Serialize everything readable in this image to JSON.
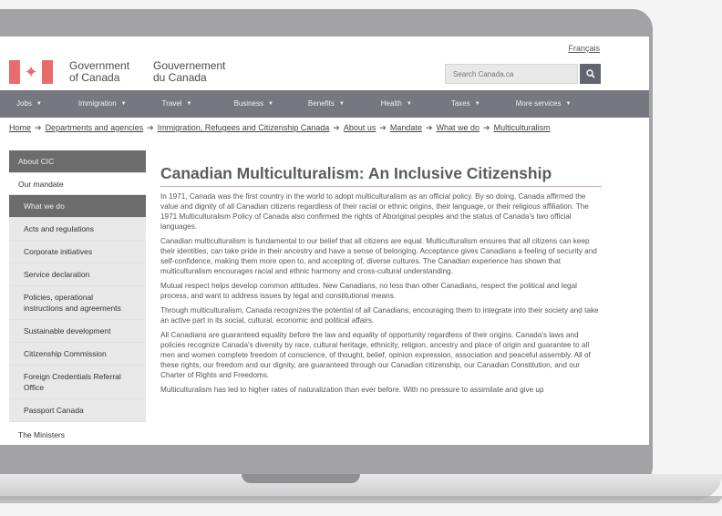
{
  "header": {
    "language_link": "Français",
    "wordmark_en_line1": "Government",
    "wordmark_en_line2": "of Canada",
    "wordmark_fr_line1": "Gouvernement",
    "wordmark_fr_line2": "du Canada",
    "search_placeholder": "Search Canada.ca"
  },
  "nav": {
    "items": [
      {
        "label": "Jobs"
      },
      {
        "label": "Immigration"
      },
      {
        "label": "Travel"
      },
      {
        "label": "Business"
      },
      {
        "label": "Benefits"
      },
      {
        "label": "Health"
      },
      {
        "label": "Taxes"
      },
      {
        "label": "More services"
      }
    ]
  },
  "breadcrumb": [
    "Home",
    "Departments and agencies",
    "Immigration, Refugees and Citizenship Canada",
    "About us",
    "Mandate",
    "What we do",
    "Multiculturalism"
  ],
  "sidebar": {
    "heading": "About CIC",
    "mandate": "Our mandate",
    "active": "What we do",
    "sub_items": [
      "Acts and regulations",
      "Corporate initiatives",
      "Service declaration",
      "Policies, operational instructions and agreements",
      "Sustainable development",
      "Citizenship Commission",
      "Foreign Credentials Referral Office",
      "Passport Canada"
    ],
    "ministers": "The Ministers"
  },
  "main": {
    "title": "Canadian Multiculturalism: An Inclusive Citizenship",
    "paragraphs": [
      "In 1971, Canada was the first country in the world to adopt multiculturalism as an official policy. By so doing, Canada affirmed the value and dignity of all Canadian citizens regardless of their racial or ethnic origins, their language, or their religious affiliation. The 1971 Multiculturalism Policy of Canada also confirmed the rights of Aboriginal peoples and the status of Canada's two official languages.",
      "Canadian multiculturalism is fundamental to our belief that all citizens are equal. Multiculturalism ensures that all citizens can keep their identities, can take pride in their ancestry and have a sense of belonging. Acceptance gives Canadians a feeling of security and self-confidence, making them more open to, and accepting of, diverse cultures. The Canadian experience has shown that multiculturalism encourages racial and ethnic harmony and cross-cultural understanding.",
      "Mutual respect helps develop common attitudes. New Canadians, no less than other Canadians, respect the political and legal process, and want to address issues by legal and constitutional means.",
      "Through multiculturalism, Canada recognizes the potential of all Canadians, encouraging them to integrate into their society and take an active part in its social, cultural, economic and political affairs.",
      "All Canadians are guaranteed equality before the law and equality of opportunity regardless of their origins. Canada's laws and policies recognize Canada's diversity by race, cultural heritage, ethnicity, religion, ancestry and place of origin and guarantee to all men and women complete freedom of conscience, of thought, belief, opinion expression, association and peaceful assembly. All of these rights, our freedom and our dignity, are guaranteed through our Canadian citizenship, our Canadian Constitution, and our Charter of Rights and Freedoms.",
      "Multiculturalism has led to higher rates of naturalization than ever before. With no pressure to assimilate and give up"
    ]
  },
  "colors": {
    "nav_bg": "#77777f",
    "flag_red": "#e86c6c",
    "sidebar_active": "#6c6c6c",
    "sidebar_sub_bg": "#e8e8e8",
    "title_text": "#5c5c5c",
    "laptop_bezel": "#a3a3a5"
  }
}
